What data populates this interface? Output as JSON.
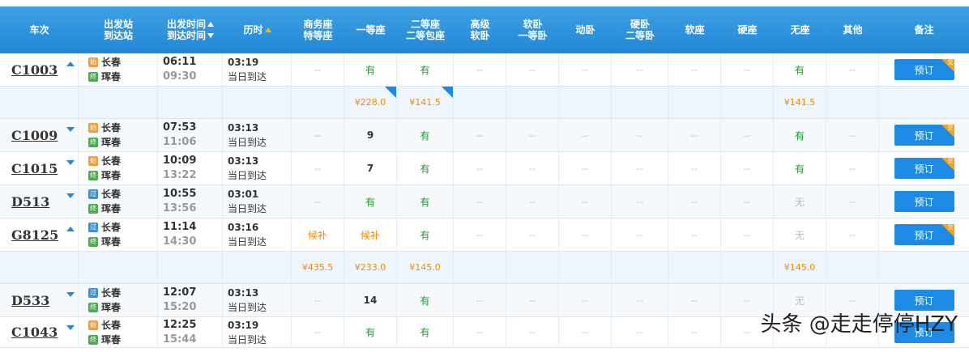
{
  "header": {
    "col_train": "车次",
    "col_station_top": "出发站",
    "col_station_bottom": "到达站",
    "col_time_top": "出发时间",
    "col_time_bottom": "到达时间",
    "col_duration": "历时",
    "col_business_top": "商务座",
    "col_business_bottom": "特等座",
    "col_first": "一等座",
    "col_second_top": "二等座",
    "col_second_bottom": "二等包座",
    "col_highsoft_top": "高级",
    "col_highsoft_bottom": "软卧",
    "col_softsleeper_top": "软卧",
    "col_softsleeper_bottom": "一等卧",
    "col_moving": "动卧",
    "col_hardsleeper_top": "硬卧",
    "col_hardsleeper_bottom": "二等卧",
    "col_softseat": "软座",
    "col_hardseat": "硬座",
    "col_noseat": "无座",
    "col_other": "其他",
    "col_remark": "备注"
  },
  "common": {
    "dash": "--",
    "book_label": "预订",
    "corner_label": "兑",
    "same_day": "当日到达",
    "start_badge": "始",
    "pass_badge": "过",
    "end_badge": "终"
  },
  "trains": [
    {
      "no": "C1003",
      "from": "长春",
      "to": "珲春",
      "from_type": "start",
      "dep": "06:11",
      "arr": "09:30",
      "dur": "03:19",
      "expanded": true,
      "business": "--",
      "first": "有",
      "second": "有",
      "noseat": "有",
      "other": "--",
      "corner": true
    },
    {
      "no": "C1009",
      "from": "长春",
      "to": "珲春",
      "from_type": "start",
      "dep": "07:53",
      "arr": "11:06",
      "dur": "03:13",
      "expanded": false,
      "business": "--",
      "first": "9",
      "second": "有",
      "noseat": "有",
      "other": "--",
      "corner": true
    },
    {
      "no": "C1015",
      "from": "长春",
      "to": "珲春",
      "from_type": "start",
      "dep": "10:09",
      "arr": "13:22",
      "dur": "03:13",
      "expanded": false,
      "business": "--",
      "first": "7",
      "second": "有",
      "noseat": "有",
      "other": "--",
      "corner": true
    },
    {
      "no": "D513",
      "from": "长春",
      "to": "珲春",
      "from_type": "pass",
      "dep": "10:55",
      "arr": "13:56",
      "dur": "03:01",
      "expanded": false,
      "business": "--",
      "first": "有",
      "second": "有",
      "noseat": "无",
      "other": "--",
      "corner": false
    },
    {
      "no": "G8125",
      "from": "长春",
      "to": "珲春",
      "from_type": "pass",
      "dep": "11:14",
      "arr": "14:30",
      "dur": "03:16",
      "expanded": true,
      "business": "候补",
      "first": "候补",
      "second": "有",
      "noseat": "无",
      "other": "--",
      "corner": true
    },
    {
      "no": "D533",
      "from": "长春",
      "to": "珲春",
      "from_type": "pass",
      "dep": "12:07",
      "arr": "15:20",
      "dur": "03:13",
      "expanded": false,
      "business": "--",
      "first": "14",
      "second": "有",
      "noseat": "无",
      "other": "--",
      "corner": false
    },
    {
      "no": "C1043",
      "from": "长春",
      "to": "珲春",
      "from_type": "start",
      "dep": "12:25",
      "arr": "15:44",
      "dur": "03:19",
      "expanded": false,
      "business": "--",
      "first": "有",
      "second": "有",
      "noseat": "",
      "other": "--",
      "corner": false
    }
  ],
  "prices": {
    "C1003": {
      "business": "",
      "first": "¥228.0",
      "second": "¥141.5",
      "noseat": "¥141.5",
      "flag_first": true,
      "flag_second": true
    },
    "G8125": {
      "business": "¥435.5",
      "first": "¥233.0",
      "second": "¥145.0",
      "noseat": "¥145.0",
      "flag_first": false,
      "flag_second": false
    }
  },
  "watermark": "头条 @走走停停HZY",
  "colors": {
    "header": "#2a8ddb",
    "available": "#1e9a2a",
    "price": "#f08a00",
    "button": "#1d8ae6"
  }
}
